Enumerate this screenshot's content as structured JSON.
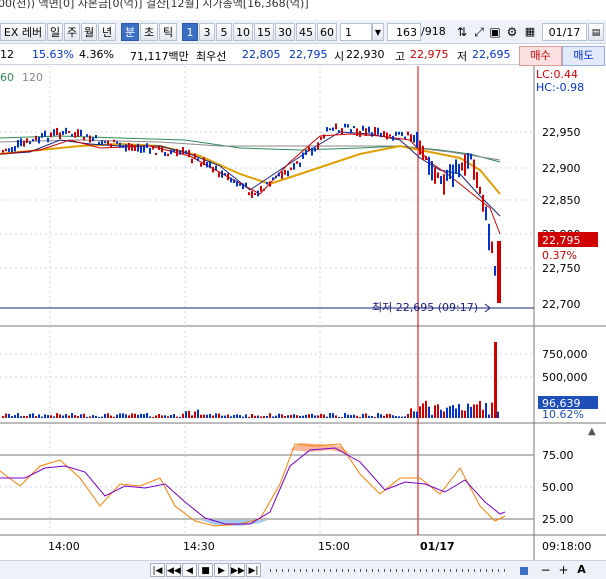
{
  "header": {
    "info_line": "00(천)) 액면[0] 자본금[0(억)] 결산[12월] 시가총액[16,368(억)]"
  },
  "toolbar": {
    "symbol": "EX 레버",
    "periods": [
      "일",
      "주",
      "월",
      "년"
    ],
    "units": [
      "분",
      "초",
      "틱"
    ],
    "intervals": [
      "1",
      "3",
      "5",
      "10",
      "15",
      "30",
      "45",
      "60"
    ],
    "interval_value": "1",
    "count": "163",
    "total": "/918",
    "date": "01/17",
    "selected_unit": "분",
    "selected_interval": "1"
  },
  "quote": {
    "code_suffix": "12",
    "turnover": "15.63%",
    "rate": "4.36%",
    "amount": "71,117백만",
    "best_label": "최우선",
    "best_ask": "22,805",
    "best_bid": "22,795",
    "open_label": "시",
    "open": "22,930",
    "high_label": "고",
    "high": "22,975",
    "low_label": "저",
    "low": "22,695",
    "buy_label": "매수",
    "sell_label": "매도"
  },
  "legend": {
    "ma_a": "60",
    "ma_b": "120"
  },
  "indicators": {
    "lc": "LC:0.44",
    "hc": "HC:-0.98"
  },
  "price_axis": [
    "22,950",
    "22,900",
    "22,850",
    "22,800",
    "22,750",
    "22,700"
  ],
  "current_price": "22,795",
  "current_change": "0.37%",
  "low_annotation": "최저 22,695 (09:17)",
  "volume_axis": [
    "750,000",
    "500,000"
  ],
  "current_volume": "96,639",
  "volume_pct": "10.62%",
  "stoch_axis": [
    "75.00",
    "50.00",
    "25.00"
  ],
  "time_labels": [
    "14:00",
    "14:30",
    "15:00",
    "01/17",
    "09:18:00"
  ],
  "colors": {
    "up": "#d10000",
    "down": "#0033cc",
    "ma_gold": "#e0a000",
    "ma_green": "#2e8b57",
    "stoch_k": "#ff7f00",
    "stoch_d": "#7a00c8"
  },
  "bottom": {
    "zoom_in": "+",
    "zoom_out": "−",
    "auto": "A"
  }
}
